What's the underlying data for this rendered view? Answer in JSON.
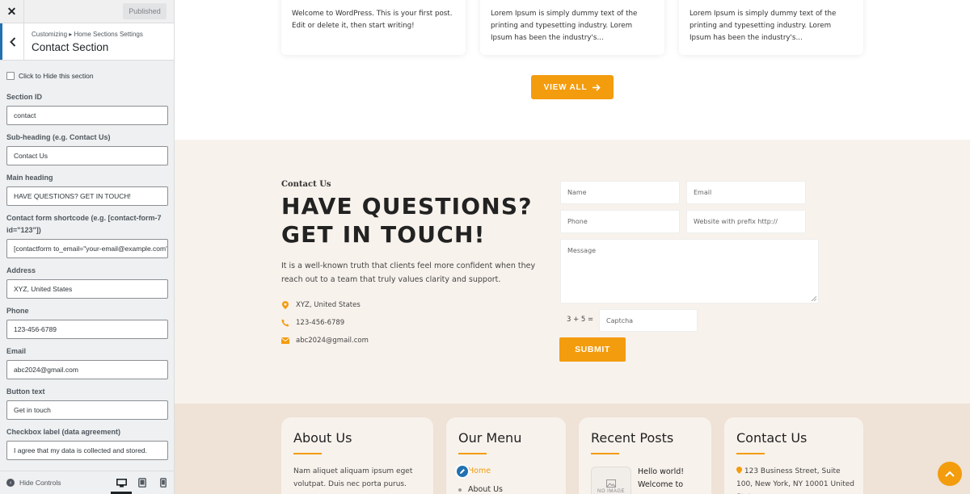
{
  "customizer": {
    "publish_label": "Published",
    "breadcrumb": "Customizing ▸ Home Sections Settings",
    "section_title": "Contact Section",
    "hide_checkbox_label": "Click to Hide this section",
    "fields": [
      {
        "label": "Section ID",
        "value": "contact"
      },
      {
        "label": "Sub-heading (e.g. Contact Us)",
        "value": "Contact Us"
      },
      {
        "label": "Main heading",
        "value": "HAVE QUESTIONS? GET IN TOUCH!"
      },
      {
        "label": "Contact form shortcode (e.g. [contact-form-7 id=\"123\"])",
        "value": "[contactform to_email=\"your-email@example.com\"]"
      },
      {
        "label": "Address",
        "value": "XYZ, United States"
      },
      {
        "label": "Phone",
        "value": "123-456-6789"
      },
      {
        "label": "Email",
        "value": "abc2024@gmail.com"
      },
      {
        "label": "Button text",
        "value": "Get in touch"
      },
      {
        "label": "Checkbox label (data agreement)",
        "value": "I agree that my data is collected and stored."
      }
    ],
    "hide_controls_label": "Hide Controls"
  },
  "preview": {
    "posts": [
      {
        "excerpt": "Welcome to WordPress. This is your first post. Edit or delete it, then start writing!"
      },
      {
        "excerpt": "Lorem Ipsum is simply dummy text of the printing and typesetting industry. Lorem Ipsum has been the industry's..."
      },
      {
        "excerpt": "Lorem Ipsum is simply dummy text of the printing and typesetting industry. Lorem Ipsum has been the industry's..."
      }
    ],
    "view_all_label": "VIEW ALL",
    "contact": {
      "subheading": "Contact Us",
      "heading": "HAVE QUESTIONS? GET IN TOUCH!",
      "description": "It is a well-known truth that clients feel more confident when they reach out to a team that truly values clarity and support.",
      "address": "XYZ, United States",
      "phone": "123-456-6789",
      "email": "abc2024@gmail.com",
      "form": {
        "name_placeholder": "Name",
        "email_placeholder": "Email",
        "phone_placeholder": "Phone",
        "website_placeholder": "Website with prefix http://",
        "message_placeholder": "Message",
        "captcha_question": "3 + 5 =",
        "captcha_placeholder": "Captcha",
        "submit_label": "SUBMIT"
      }
    },
    "footer": {
      "about": {
        "title": "About Us",
        "text": "Nam aliquet aliquam ipsum eget volutpat. Duis nec porta purus."
      },
      "menu": {
        "title": "Our Menu",
        "items": [
          "Home",
          "About Us"
        ]
      },
      "recent": {
        "title": "Recent Posts",
        "no_image": "NO IMAGE",
        "post_title": "Hello world! Welcome to WordPress. This"
      },
      "contact": {
        "title": "Contact Us",
        "address": "123 Business Street, Suite 100, New York, NY 10001",
        "address_tail": "United States"
      }
    }
  },
  "colors": {
    "accent": "#f39c0e",
    "wp_blue": "#2271b1",
    "contact_bg": "#f8f2ec",
    "footer_bg": "#efe2d6"
  },
  "icons": [
    "close-icon",
    "chevron-left-icon",
    "desktop-icon",
    "tablet-icon",
    "mobile-icon",
    "map-marker-icon",
    "phone-icon",
    "envelope-icon",
    "arrow-right-icon",
    "pencil-icon",
    "chevron-up-icon"
  ]
}
